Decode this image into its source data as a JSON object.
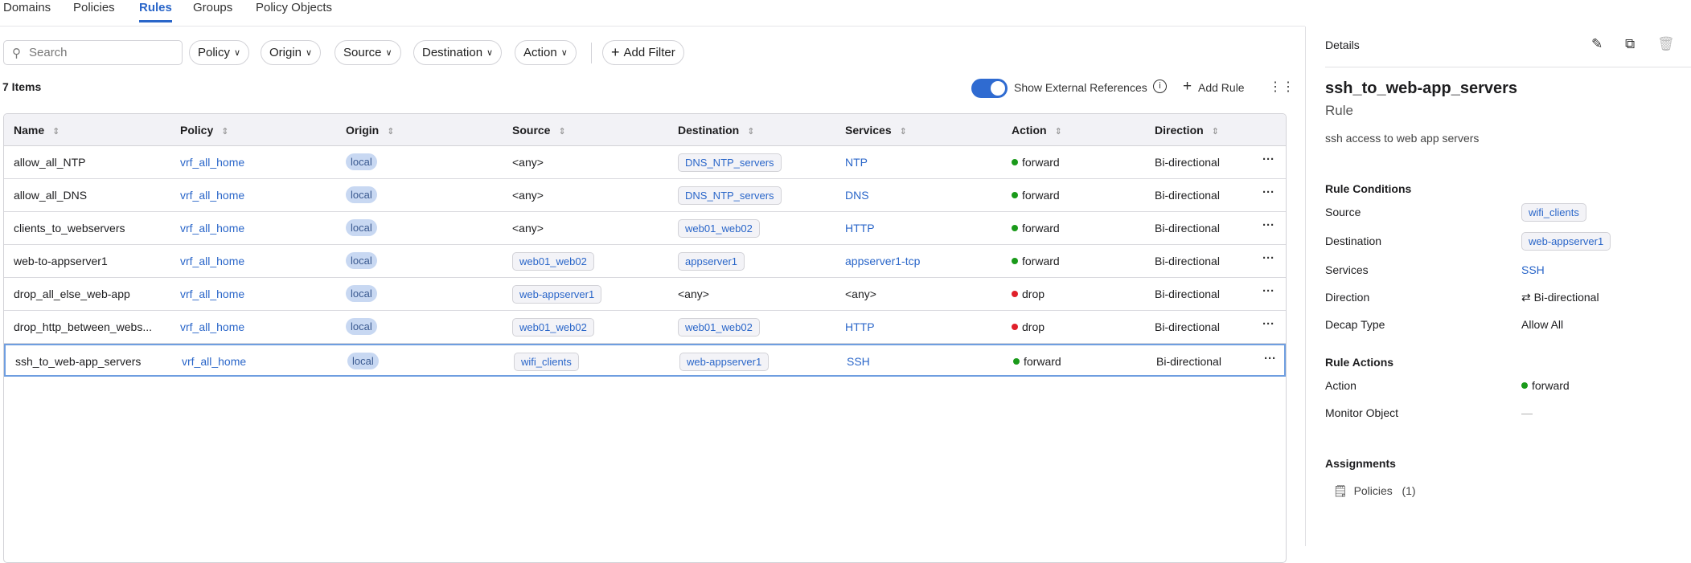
{
  "tabs": [
    "Domains",
    "Policies",
    "Rules",
    "Groups",
    "Policy Objects"
  ],
  "search": {
    "placeholder": "Search"
  },
  "filters": [
    "Policy",
    "Origin",
    "Source",
    "Destination",
    "Action"
  ],
  "add_filter": "Add Filter",
  "items_count": "7 Items",
  "toolbar": {
    "show_external": "Show External References",
    "show_external_on": true,
    "add_rule": "Add Rule"
  },
  "columns": [
    "Name",
    "Policy",
    "Origin",
    "Source",
    "Destination",
    "Services",
    "Action",
    "Direction"
  ],
  "rows": [
    {
      "name": "allow_all_NTP",
      "policy": "vrf_all_home",
      "origin": "local",
      "source": "<any>",
      "source_tag": false,
      "destination": "DNS_NTP_servers",
      "dest_tag": true,
      "services": "NTP",
      "services_link": true,
      "action": "forward",
      "direction": "Bi-directional"
    },
    {
      "name": "allow_all_DNS",
      "policy": "vrf_all_home",
      "origin": "local",
      "source": "<any>",
      "source_tag": false,
      "destination": "DNS_NTP_servers",
      "dest_tag": true,
      "services": "DNS",
      "services_link": true,
      "action": "forward",
      "direction": "Bi-directional"
    },
    {
      "name": "clients_to_webservers",
      "policy": "vrf_all_home",
      "origin": "local",
      "source": "<any>",
      "source_tag": false,
      "destination": "web01_web02",
      "dest_tag": true,
      "services": "HTTP",
      "services_link": true,
      "action": "forward",
      "direction": "Bi-directional"
    },
    {
      "name": "web-to-appserver1",
      "policy": "vrf_all_home",
      "origin": "local",
      "source": "web01_web02",
      "source_tag": true,
      "destination": "appserver1",
      "dest_tag": true,
      "services": "appserver1-tcp",
      "services_link": true,
      "action": "forward",
      "direction": "Bi-directional"
    },
    {
      "name": "drop_all_else_web-app",
      "policy": "vrf_all_home",
      "origin": "local",
      "source": "web-appserver1",
      "source_tag": true,
      "destination": "<any>",
      "dest_tag": false,
      "services": "<any>",
      "services_link": false,
      "action": "drop",
      "direction": "Bi-directional"
    },
    {
      "name": "drop_http_between_webs...",
      "policy": "vrf_all_home",
      "origin": "local",
      "source": "web01_web02",
      "source_tag": true,
      "destination": "web01_web02",
      "dest_tag": true,
      "services": "HTTP",
      "services_link": true,
      "action": "drop",
      "direction": "Bi-directional"
    },
    {
      "name": "ssh_to_web-app_servers",
      "policy": "vrf_all_home",
      "origin": "local",
      "source": "wifi_clients",
      "source_tag": true,
      "destination": "web-appserver1",
      "dest_tag": true,
      "services": "SSH",
      "services_link": true,
      "action": "forward",
      "direction": "Bi-directional",
      "selected": true
    }
  ],
  "colors": {
    "forward": "#1a9a1a",
    "drop": "#e0202a",
    "accent": "#2a66c9"
  },
  "details": {
    "header": "Details",
    "title": "ssh_to_web-app_servers",
    "type": "Rule",
    "description": "ssh access to web app servers",
    "conditions_heading": "Rule Conditions",
    "source_label": "Source",
    "source": "wifi_clients",
    "destination_label": "Destination",
    "destination": "web-appserver1",
    "services_label": "Services",
    "services": "SSH",
    "direction_label": "Direction",
    "direction": "Bi-directional",
    "decap_label": "Decap Type",
    "decap": "Allow All",
    "actions_heading": "Rule Actions",
    "action_label": "Action",
    "action": "forward",
    "monitor_label": "Monitor Object",
    "monitor": "—",
    "assignments_heading": "Assignments",
    "policies_label": "Policies",
    "policies_count": "(1)"
  }
}
